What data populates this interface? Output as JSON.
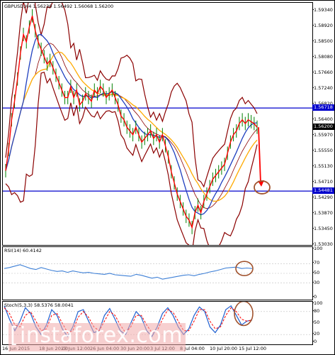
{
  "symbol_header": "GBPUSD,H4  1.56230 1.56492 1.56068 1.56200",
  "rsi_header": "RSI(14) 60.4142",
  "stoch_header": "Stoch(5,3,3) 58.5376 58.0041",
  "price_axis": [
    "1.59340",
    "1.58920",
    "1.58500",
    "1.58080",
    "1.57660",
    "1.57240",
    "1.56820",
    "1.56400",
    "1.55970",
    "1.55550",
    "1.55130",
    "1.54710",
    "1.54290",
    "1.53870",
    "1.53450",
    "1.53030"
  ],
  "rsi_axis": [
    "100",
    "70",
    "50",
    "30",
    "0"
  ],
  "stoch_axis": [
    "100",
    "80",
    "50",
    "20",
    "0"
  ],
  "level_tags": {
    "upper": "1.56718",
    "lower": "1.54481",
    "current": "1.56200"
  },
  "time_axis": [
    "16 Jun 2015",
    "18 Jun 20:00",
    "23 Jun 12:00",
    "26 Jun 04:00",
    "30 Jun 20:00",
    "3 Jul 12:00",
    "8 Jul 04:00",
    "10 Jul 20:00",
    "15 Jul 12:00"
  ],
  "watermark": "instaforex.com",
  "colors": {
    "level_line": "#0000cc",
    "bollinger": "#8b0000",
    "ma_fast": "#1f3fbf",
    "ma_slow": "#ffaa00",
    "candles": "#008000",
    "close_line": "#ff0000",
    "rsi": "#3d7fd6",
    "stoch_main": "#1e5fd0",
    "stoch_signal": "#ff0000",
    "forecast_arrow": "#ff0000",
    "target_circle": "#a0522d"
  },
  "chart_data": {
    "type": "line",
    "title": "GBPUSD,H4",
    "ylim": [
      1.5303,
      1.5955
    ],
    "levels": [
      1.56718,
      1.54481
    ],
    "close": [
      1.5503,
      1.556,
      1.564,
      1.569,
      1.575,
      1.582,
      1.587,
      1.585,
      1.589,
      1.592,
      1.588,
      1.585,
      1.583,
      1.581,
      1.579,
      1.58,
      1.578,
      1.576,
      1.574,
      1.572,
      1.57,
      1.57,
      1.573,
      1.57,
      1.572,
      1.568,
      1.569,
      1.571,
      1.57,
      1.569,
      1.572,
      1.571,
      1.573,
      1.572,
      1.57,
      1.571,
      1.572,
      1.57,
      1.568,
      1.565,
      1.564,
      1.562,
      1.561,
      1.56,
      1.562,
      1.56,
      1.558,
      1.559,
      1.56,
      1.561,
      1.559,
      1.56,
      1.558,
      1.56,
      1.557,
      1.554,
      1.55,
      1.547,
      1.544,
      1.542,
      1.54,
      1.538,
      1.537,
      1.535,
      1.539,
      1.541,
      1.539,
      1.542,
      1.544,
      1.546,
      1.548,
      1.549,
      1.55,
      1.551,
      1.552,
      1.555,
      1.558,
      1.56,
      1.561,
      1.563,
      1.564,
      1.563,
      1.564,
      1.5635,
      1.563,
      1.562
    ],
    "forecast": {
      "from": 1.562,
      "to": 1.546
    }
  },
  "rsi_values": [
    60,
    62,
    65,
    68,
    64,
    60,
    58,
    62,
    59,
    56,
    54,
    55,
    52,
    55,
    53,
    51,
    52,
    50,
    49,
    48,
    50,
    47,
    46,
    45,
    44,
    48,
    46,
    43,
    40,
    42,
    38,
    40,
    42,
    44,
    46,
    47,
    45,
    48,
    50,
    53,
    55,
    58,
    61,
    62,
    63,
    60,
    61,
    60
  ],
  "stoch_main": [
    95,
    60,
    30,
    55,
    90,
    75,
    40,
    20,
    45,
    85,
    70,
    35,
    15,
    40,
    80,
    85,
    55,
    25,
    30,
    70,
    88,
    60,
    30,
    20,
    50,
    80,
    65,
    30,
    15,
    40,
    75,
    90,
    70,
    40,
    20,
    35,
    70,
    92,
    80,
    40,
    25,
    45,
    85,
    95,
    70,
    45,
    55,
    58
  ],
  "stoch_signal": [
    90,
    75,
    45,
    40,
    70,
    80,
    55,
    30,
    35,
    70,
    75,
    50,
    25,
    30,
    65,
    80,
    65,
    40,
    30,
    55,
    80,
    70,
    45,
    25,
    40,
    70,
    70,
    45,
    25,
    30,
    60,
    85,
    78,
    55,
    30,
    30,
    55,
    85,
    85,
    55,
    35,
    40,
    70,
    90,
    80,
    60,
    55,
    58
  ]
}
